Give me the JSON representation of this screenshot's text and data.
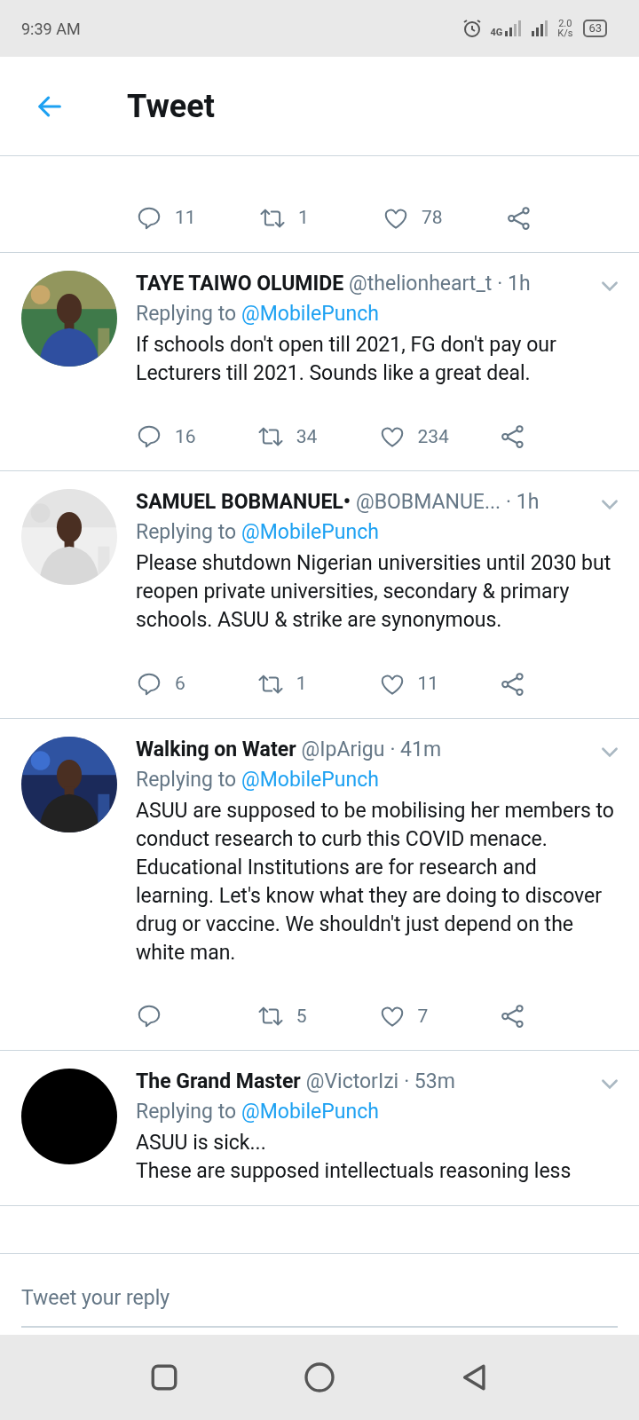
{
  "status_bar": {
    "time": "9:39 AM",
    "network": "4G",
    "speed": "2.0",
    "speed_unit": "K/s",
    "battery": "63"
  },
  "header": {
    "title": "Tweet"
  },
  "partial_tweet": {
    "actions": [
      {
        "kind": "reply",
        "count": "11"
      },
      {
        "kind": "retweet",
        "count": "1"
      },
      {
        "kind": "like",
        "count": "78"
      },
      {
        "kind": "share"
      }
    ]
  },
  "tweets": [
    {
      "name": "TAYE TAIWO OLUMIDE",
      "handle": "@thelionheart_t",
      "time": "· 1h",
      "replying_label": "Replying to",
      "replying_to": "@MobilePunch",
      "body": "If schools don't open till 2021, FG don't pay our Lecturers till 2021. Sounds like a great deal.",
      "actions": [
        {
          "kind": "reply",
          "count": "16"
        },
        {
          "kind": "retweet",
          "count": "34"
        },
        {
          "kind": "like",
          "count": "234"
        },
        {
          "kind": "share"
        }
      ]
    },
    {
      "name": "SAMUEL BOBMANUEL•",
      "handle": "@BOBMANUE...",
      "time": "· 1h",
      "replying_label": "Replying to",
      "replying_to": "@MobilePunch",
      "body": "Please shutdown Nigerian universities until 2030 but reopen private universities, secondary & primary schools. ASUU & strike are synonymous.",
      "actions": [
        {
          "kind": "reply",
          "count": "6"
        },
        {
          "kind": "retweet",
          "count": "1"
        },
        {
          "kind": "like",
          "count": "11"
        },
        {
          "kind": "share"
        }
      ]
    },
    {
      "name": "Walking on Water",
      "handle": "@IpArigu",
      "time": "· 41m",
      "replying_label": "Replying to",
      "replying_to": "@MobilePunch",
      "body": "ASUU are supposed to be mobilising her members to conduct research to curb this COVID menace. Educational Institutions are for research and learning. Let's know what they are doing to discover drug or vaccine. We shouldn't just depend on the white man.",
      "actions": [
        {
          "kind": "reply"
        },
        {
          "kind": "retweet",
          "count": "5"
        },
        {
          "kind": "like",
          "count": "7"
        },
        {
          "kind": "share"
        }
      ]
    },
    {
      "name": "The Grand Master",
      "handle": "@VictorIzi",
      "time": "· 53m",
      "replying_label": "Replying to",
      "replying_to": "@MobilePunch",
      "avatar": {
        "kind": "blank"
      },
      "body": "ASUU is sick...\nThese are supposed intellectuals reasoning less"
    }
  ],
  "compose": {
    "placeholder": "Tweet your reply"
  }
}
